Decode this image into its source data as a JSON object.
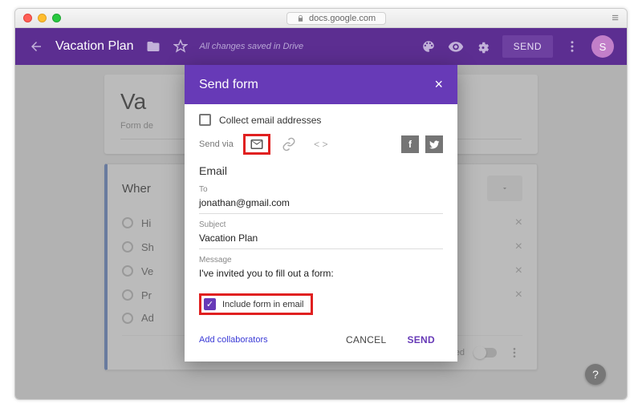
{
  "browser": {
    "url": "docs.google.com"
  },
  "toolbar": {
    "title": "Vacation Plan",
    "saved_status": "All changes saved in Drive",
    "send_label": "SEND",
    "avatar_initial": "S"
  },
  "form": {
    "title_visible": "Va",
    "description_visible": "Form de",
    "question_title_visible": "Wher",
    "options_visible": [
      "Hi",
      "Sh",
      "Ve",
      "Pr",
      "Ad"
    ],
    "footer": {
      "required_label": "Required"
    }
  },
  "dialog": {
    "title": "Send form",
    "collect_label": "Collect email addresses",
    "send_via_label": "Send via",
    "section_heading": "Email",
    "to_label": "To",
    "to_value": "jonathan@gmail.com",
    "subject_label": "Subject",
    "subject_value": "Vacation Plan",
    "message_label": "Message",
    "message_value": "I've invited you to fill out a form:",
    "include_label": "Include form in email",
    "add_collaborators": "Add collaborators",
    "cancel": "CANCEL",
    "send": "SEND"
  }
}
